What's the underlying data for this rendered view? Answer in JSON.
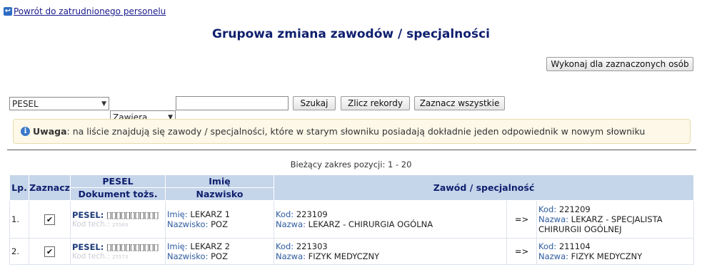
{
  "back_link": {
    "label": "Powrót do zatrudnionego personelu"
  },
  "page_title": "Grupowa zmiana zawodów / specjalności",
  "toolbar": {
    "run_label": "Wykonaj dla zaznaczonych osób",
    "field_select": "PESEL",
    "operator_select": "Zawiera",
    "search_value": "",
    "search_label": "Szukaj",
    "count_label": "Zlicz rekordy",
    "select_all_label": "Zaznacz wszystkie"
  },
  "note": {
    "bold": "Uwaga",
    "text": ": na liście znajdują się zawody / specjalności, które w starym słowniku posiadają dokładnie jeden odpowiednik w nowym słowniku"
  },
  "range_text": "Bieżący zakres pozycji: 1 - 20",
  "table": {
    "headers": {
      "lp": "Lp.",
      "select": "Zaznacz",
      "pesel": "PESEL",
      "document": "Dokument tożs.",
      "first_name": "Imię",
      "last_name": "Nazwisko",
      "profession": "Zawód / specjalność"
    },
    "labels": {
      "pesel": "PESEL:",
      "tech_code": "Kod tech.:",
      "first_name": "Imię:",
      "last_name": "Nazwisko:",
      "code": "Kod:",
      "name": "Nazwa:",
      "arrow": "=>"
    },
    "rows": [
      {
        "lp": "1.",
        "checked": true,
        "pesel": "[][][][][][][][][][][]",
        "tech_code": "25569",
        "first_name": "LEKARZ 1",
        "last_name": "POZ",
        "old_code": "223109",
        "old_name": "LEKARZ - CHIRURGIA OGÓLNA",
        "new_code": "221209",
        "new_name": "LEKARZ - SPECJALISTA CHIRURGII OGÓLNEJ"
      },
      {
        "lp": "2.",
        "checked": true,
        "pesel": "[][][][][][][][][][][]",
        "tech_code": "25573",
        "first_name": "LEKARZ 2",
        "last_name": "POZ",
        "old_code": "221303",
        "old_name": "FIZYK MEDYCZNY",
        "new_code": "211104",
        "new_name": "FIZYK MEDYCZNY"
      }
    ]
  }
}
